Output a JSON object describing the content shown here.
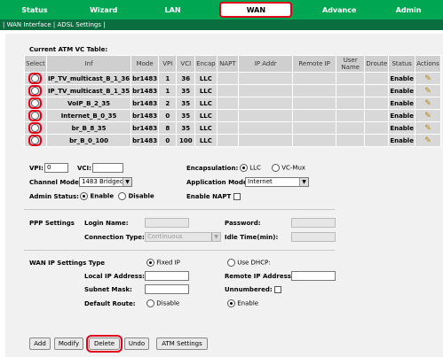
{
  "nav": {
    "tabs": [
      "Status",
      "Wizard",
      "LAN",
      "WAN",
      "Advance",
      "Admin"
    ],
    "active": "WAN"
  },
  "subnav": {
    "text": "| WAN Interface | ADSL Settings |"
  },
  "table": {
    "title": "Current ATM VC Table:",
    "headers": [
      "Select",
      "Inf",
      "Mode",
      "VPI",
      "VCI",
      "Encap",
      "NAPT",
      "IP Addr",
      "Remote IP",
      "User Name",
      "Droute",
      "Status",
      "Actions"
    ],
    "rows": [
      {
        "inf": "IP_TV_multicast_B_1_36",
        "mode": "br1483",
        "vpi": "1",
        "vci": "36",
        "encap": "LLC",
        "status": "Enable"
      },
      {
        "inf": "IP_TV_multicast_B_1_35",
        "mode": "br1483",
        "vpi": "1",
        "vci": "35",
        "encap": "LLC",
        "status": "Enable"
      },
      {
        "inf": "VoIP_B_2_35",
        "mode": "br1483",
        "vpi": "2",
        "vci": "35",
        "encap": "LLC",
        "status": "Enable"
      },
      {
        "inf": "Internet_B_0_35",
        "mode": "br1483",
        "vpi": "0",
        "vci": "35",
        "encap": "LLC",
        "status": "Enable"
      },
      {
        "inf": "br_B_8_35",
        "mode": "br1483",
        "vpi": "8",
        "vci": "35",
        "encap": "LLC",
        "status": "Enable"
      },
      {
        "inf": "br_B_0_100",
        "mode": "br1483",
        "vpi": "0",
        "vci": "100",
        "encap": "LLC",
        "status": "Enable"
      }
    ]
  },
  "form": {
    "vpi_label": "VPI:",
    "vpi_value": "0",
    "vci_label": "VCI:",
    "vci_value": "",
    "encap_label": "Encapsulation:",
    "encap_llc": "LLC",
    "encap_vcmux": "VC-Mux",
    "channel_mode_label": "Channel Mode",
    "channel_mode_value": "1483 Bridged",
    "app_mode_label": "Application Mode",
    "app_mode_value": "Internet",
    "admin_label": "Admin Status:",
    "admin_enable": "Enable",
    "admin_disable": "Disable",
    "enable_napt_label": "Enable NAPT"
  },
  "ppp": {
    "section": "PPP Settings",
    "login_label": "Login Name:",
    "password_label": "Password:",
    "conn_type_label": "Connection Type:",
    "conn_type_value": "Continuous",
    "idle_label": "Idle Time(min):"
  },
  "wanip": {
    "section": "WAN IP Settings Type",
    "fixed": "Fixed IP",
    "dhcp": "Use DHCP:",
    "local_label": "Local IP Address:",
    "remote_label": "Remote IP Address:",
    "subnet_label": "Subnet Mask:",
    "unnumbered_label": "Unnumbered:",
    "route_label": "Default Route:",
    "route_disable": "Disable",
    "route_enable": "Enable"
  },
  "buttons": {
    "add": "Add",
    "modify": "Modify",
    "delete": "Delete",
    "undo": "Undo",
    "atm": "ATM Settings"
  },
  "colors": {
    "nav_green": "#00a651",
    "sub_green": "#0a6e3f",
    "highlight": "#e3001b"
  }
}
